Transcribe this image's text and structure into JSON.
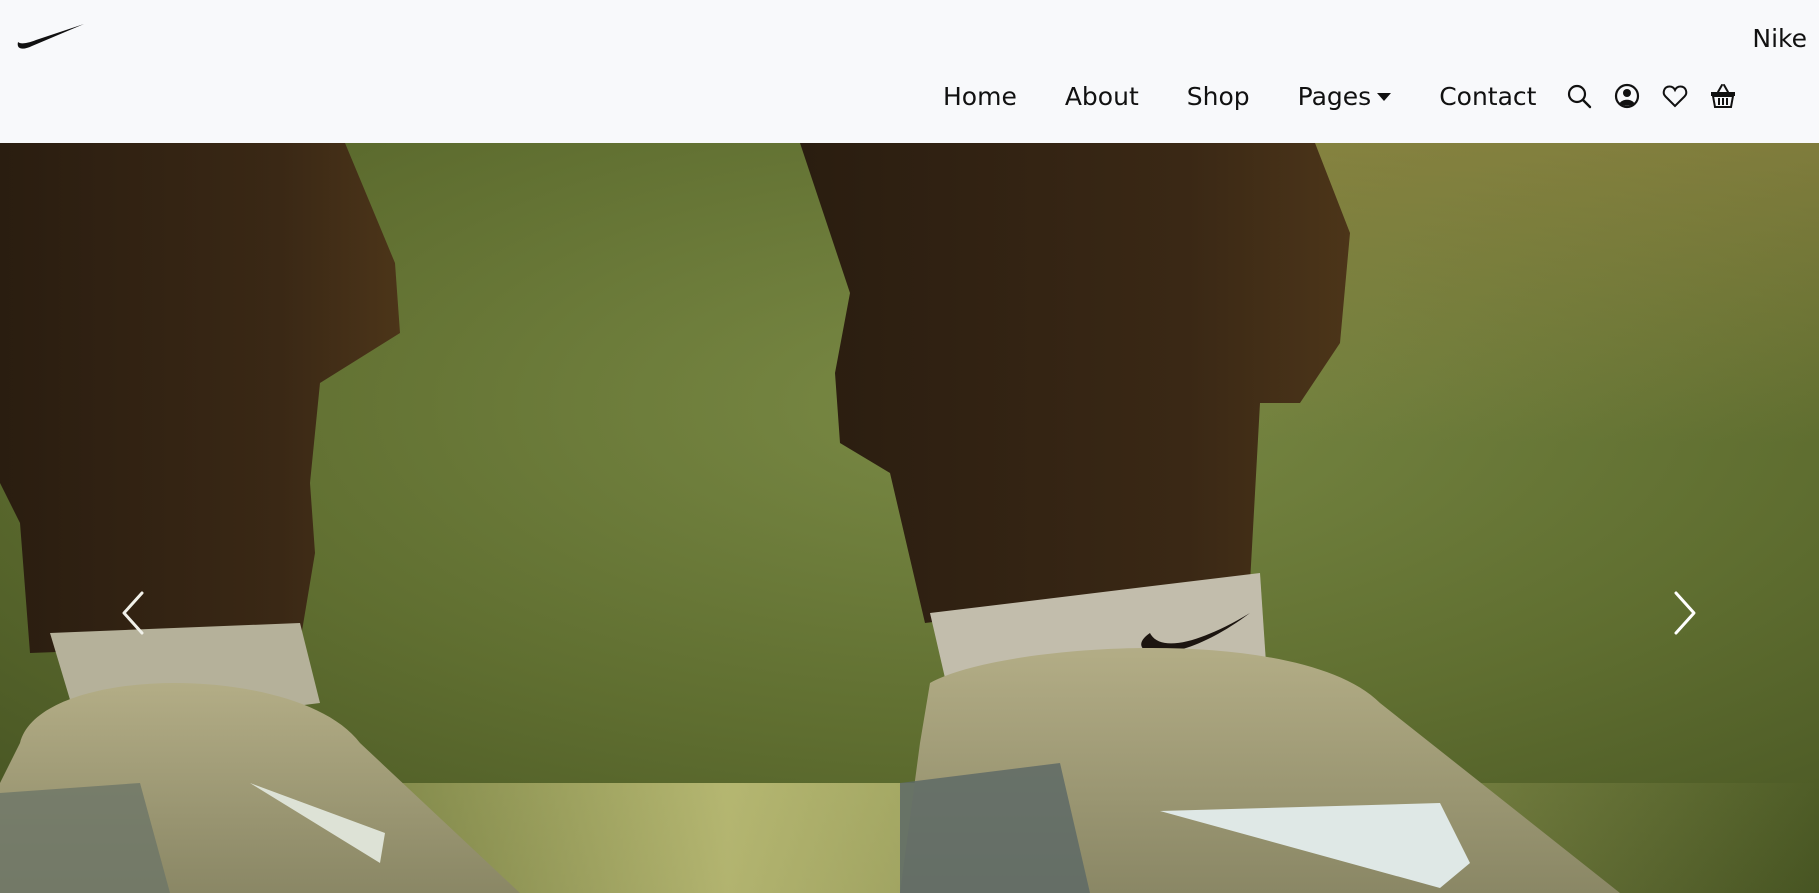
{
  "brand": {
    "name": "Nike",
    "logo_icon": "swoosh-icon"
  },
  "nav": {
    "links": [
      {
        "label": "Home"
      },
      {
        "label": "About"
      },
      {
        "label": "Shop"
      },
      {
        "label": "Pages",
        "has_dropdown": true
      },
      {
        "label": "Contact"
      }
    ],
    "icons": [
      "search-icon",
      "user-icon",
      "heart-icon",
      "basket-icon"
    ]
  },
  "hero": {
    "carousel_controls": [
      "chevron-left-icon",
      "chevron-right-icon"
    ]
  }
}
